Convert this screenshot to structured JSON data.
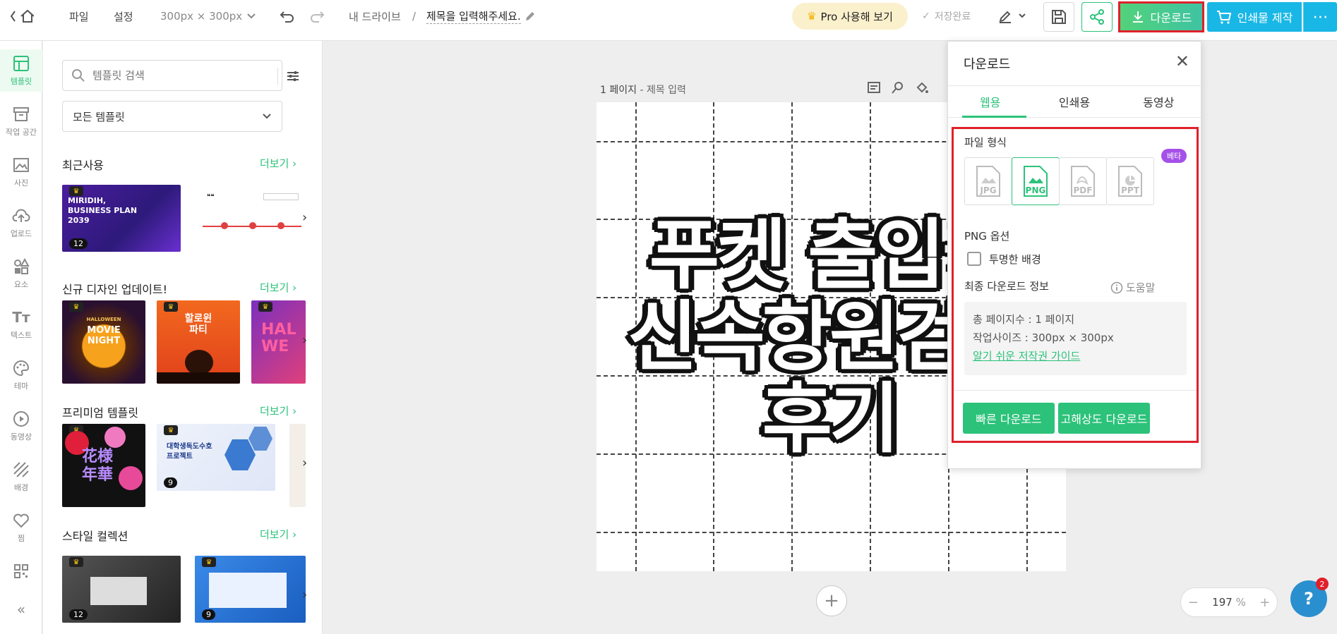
{
  "topbar": {
    "file": "파일",
    "settings": "설정",
    "size": "300px × 300px",
    "drive": "내 드라이브",
    "sep": "/",
    "doc_title": "제목을 입력해주세요.",
    "pro": "Pro 사용해 보기",
    "saved": "저장완료",
    "download": "다운로드",
    "print": "인쇄물 제작",
    "more": "⋯"
  },
  "rail": [
    {
      "label": "템플릿",
      "icon": "template-icon"
    },
    {
      "label": "작업 공간",
      "icon": "workspace-icon"
    },
    {
      "label": "사진",
      "icon": "photo-icon"
    },
    {
      "label": "업로드",
      "icon": "upload-icon"
    },
    {
      "label": "요소",
      "icon": "elements-icon"
    },
    {
      "label": "텍스트",
      "icon": "text-icon"
    },
    {
      "label": "테마",
      "icon": "palette-icon"
    },
    {
      "label": "동영상",
      "icon": "video-icon"
    },
    {
      "label": "배경",
      "icon": "background-icon"
    },
    {
      "label": "찜",
      "icon": "heart-icon"
    },
    {
      "label": "",
      "icon": "qr-icon"
    },
    {
      "label": "«",
      "icon": "collapse-icon"
    }
  ],
  "templates": {
    "search_placeholder": "템플릿 검색",
    "filter": "모든 템플릿",
    "more": "더보기",
    "sections": [
      {
        "title": "최근사용"
      },
      {
        "title": "신규 디자인 업데이트!"
      },
      {
        "title": "프리미엄 템플릿"
      },
      {
        "title": "스타일 컬렉션"
      }
    ],
    "recent_1": {
      "line1": "MIRIDIH,",
      "line2": "BUSINESS PLAN",
      "line3": "2039",
      "count": "12"
    },
    "new_1": {
      "line1": "MOVIE",
      "line2": "NIGHT",
      "small": "HALLOWEEN"
    },
    "new_2": {
      "line1": "할로윈",
      "line2": "파티"
    },
    "new_3": {
      "line1": "HAL",
      "line2": "WE"
    },
    "prem_1": {
      "line1": "花様",
      "line2": "年華"
    },
    "prem_2": {
      "line1": "대학생독도수호",
      "line2": "프로젝트",
      "count": "9"
    },
    "style_1_count": "12",
    "style_2_count": "9"
  },
  "canvas": {
    "page_label": "1 페이지",
    "page_sub": " - 제목 입력",
    "text_line1": "푸켓 출입국",
    "text_line2": "신속항원검사",
    "text_line3": "후기",
    "zoom": "197",
    "zoom_unit": "%",
    "help_badge": "2"
  },
  "download_panel": {
    "title": "다운로드",
    "tabs": [
      "웹용",
      "인쇄용",
      "동영상"
    ],
    "file_format_label": "파일 형식",
    "formats": [
      "JPG",
      "PNG",
      "PDF",
      "PPT"
    ],
    "beta": "베타",
    "png_options_label": "PNG 옵션",
    "transparent_bg": "투명한 배경",
    "final_info_label": "최종 다운로드 정보",
    "help": "도움말",
    "total_pages": "총 페이지수 : 1 페이지",
    "work_size": "작업사이즈 : 300px × 300px",
    "copyright_guide": "알기 쉬운 저작권 가이드",
    "fast_download": "빠른 다운로드",
    "hq_download": "고해상도 다운로드"
  },
  "colors": {
    "accent": "#2cc27a",
    "highlight": "#e0202a",
    "print": "#19b7e6"
  }
}
